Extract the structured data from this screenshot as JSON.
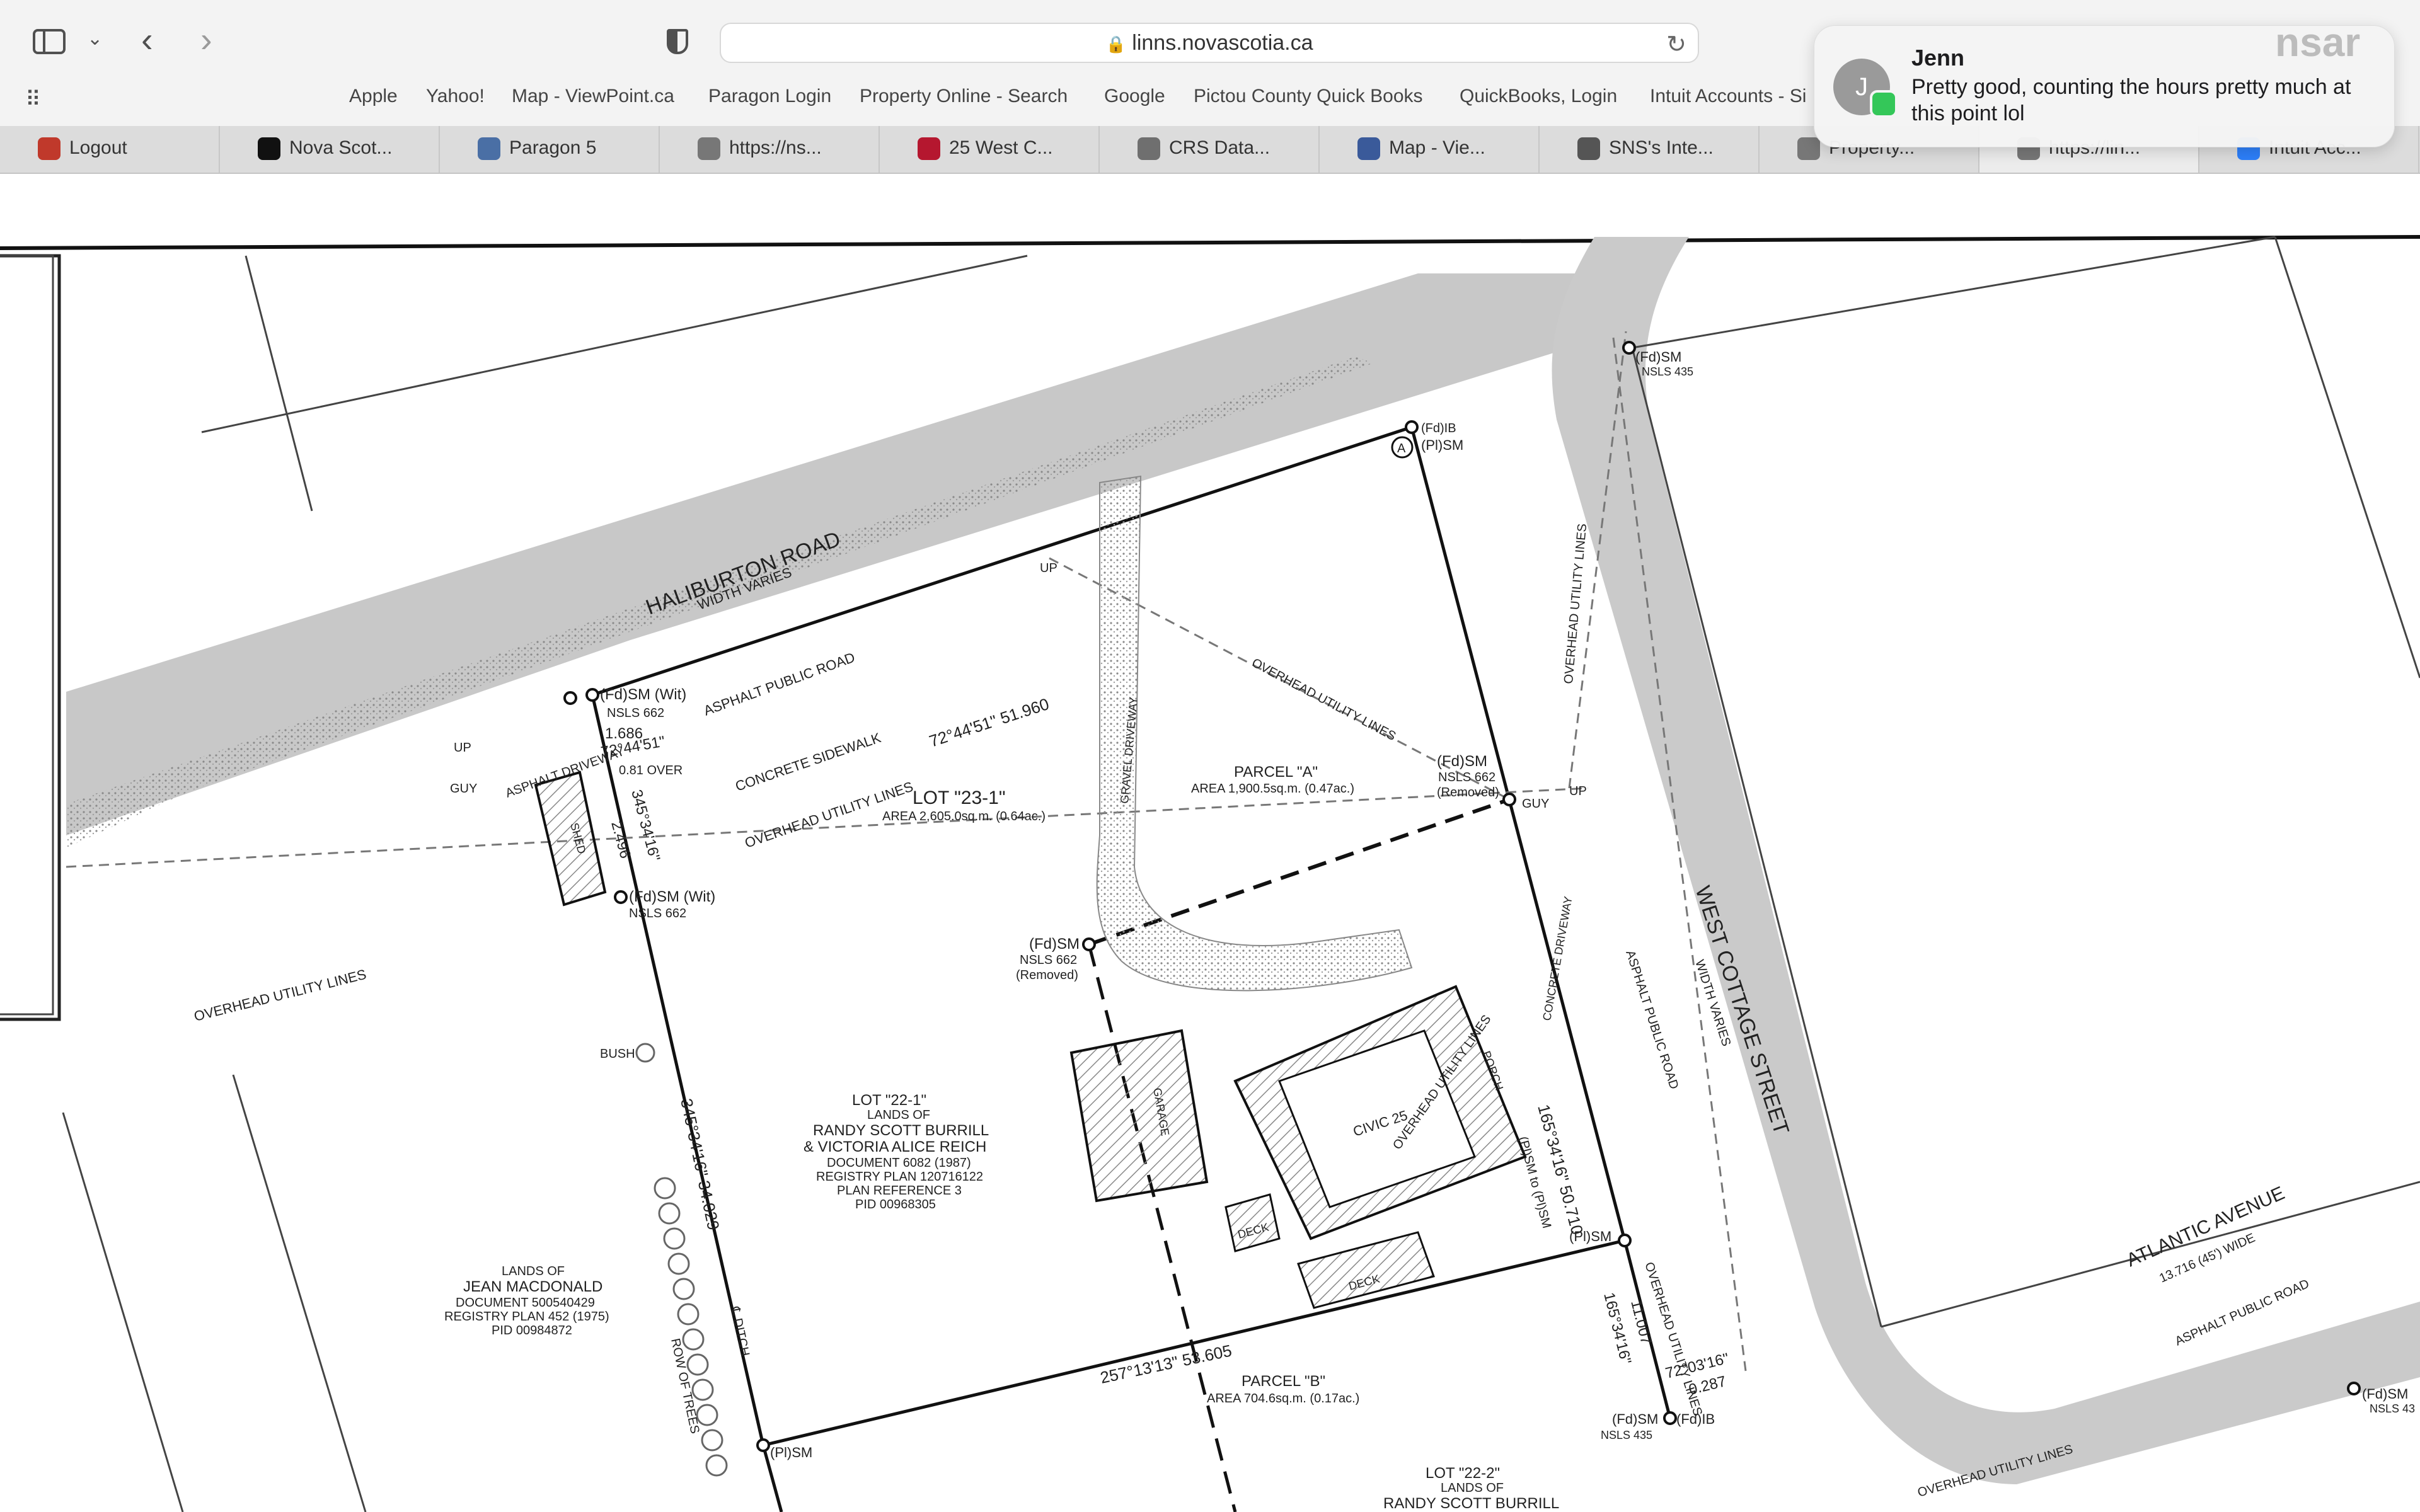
{
  "browser": {
    "url": "linns.novascotia.ca",
    "sidebar_icon": "sidebar-icon",
    "back_icon": "chevron-left-icon",
    "forward_icon": "chevron-right-icon",
    "privacy_icon": "shield-icon",
    "reload_icon": "reload-icon",
    "grid_icon": "grid-icon"
  },
  "bookmarks": [
    "Apple",
    "Yahoo!",
    "Map - ViewPoint.ca",
    "Paragon Login",
    "Property Online - Search",
    "Google",
    "Pictou County Quick Books",
    "QuickBooks, Login",
    "Intuit Accounts - Si"
  ],
  "tabs": [
    {
      "title": "Logout",
      "color": "#c0392b"
    },
    {
      "title": "Nova Scot...",
      "color": "#111111"
    },
    {
      "title": "Paragon 5",
      "color": "#4a6fa5"
    },
    {
      "title": "https://ns...",
      "color": "#777777"
    },
    {
      "title": "25 West C...",
      "color": "#b5172f"
    },
    {
      "title": "CRS Data...",
      "color": "#6f6f6f"
    },
    {
      "title": "Map - Vie...",
      "color": "#3a5a9a"
    },
    {
      "title": "SNS's Inte...",
      "color": "#555555"
    },
    {
      "title": "Property...",
      "color": "#777777"
    },
    {
      "title": "https://lin...",
      "color": "#777777"
    },
    {
      "title": "Intuit Acc...",
      "color": "#2d7ff9"
    }
  ],
  "notification": {
    "avatar_letter": "J",
    "sender": "Jenn",
    "message": "Pretty good, counting the hours pretty much at this point lol",
    "app_icon": "messages-icon"
  },
  "watermark": "nsar",
  "survey": {
    "haliburton_road": "HALIBURTON ROAD",
    "width_varies": "WIDTH VARIES",
    "asphalt_public_road": "ASPHALT PUBLIC ROAD",
    "concrete_sidewalk": "CONCRETE SIDEWALK",
    "overhead_utility_lines": "OVERHEAD UTILITY LINES",
    "bearing_north": "72°44'51\"  51.960",
    "up": "UP",
    "guy": "GUY",
    "fdsm_wit": "(Fd)SM (Wit)",
    "nsls_662": "NSLS 662",
    "nsls_435": "NSLS 435",
    "dist_1686": "1.686",
    "bearing_72": "72°44'51\"",
    "over": "0.81 OVER",
    "asphalt_driveway": "ASPHALT DRIVEWAY",
    "shed": "SHED",
    "bearing_345_short": "345°34'16\"",
    "dist_2496": "2.496",
    "lot_23_1": "LOT \"23-1\"",
    "lot_23_1_area": "AREA 2,605.0sq.m. (0.64ac.)",
    "gravel_driveway": "GRAVEL DRIVEWAY",
    "parcel_a": "PARCEL \"A\"",
    "parcel_a_area": "AREA 1,900.5sq.m. (0.47ac.)",
    "fdib": "(Fd)IB",
    "plsm": "(Pl)SM",
    "fdsm": "(Fd)SM",
    "removed": "(Removed)",
    "fdsm_top": "(Fd)SM",
    "west_cottage_street": "WEST COTTAGE STREET",
    "concrete_driveway": "CONCRETE DRIVEWAY",
    "bearing_east": "165°34'16\"  50.710",
    "plsm_to_plsm": "(Pl)SM to (Pl)SM",
    "bush": "BUSH",
    "lot_22_1": "LOT \"22-1\"",
    "lands_of": "LANDS OF",
    "owner_1": "RANDY SCOTT BURRILL",
    "owner_2": "& VICTORIA ALICE REICH",
    "doc_6082": "DOCUMENT 6082 (1987)",
    "registry_plan": "REGISTRY PLAN 120716122",
    "plan_reference": "PLAN REFERENCE 3",
    "pid_968305": "PID 00968305",
    "garage": "GARAGE",
    "deck": "DECK",
    "civic_25": "CIVIC 25",
    "porch": "PORCH",
    "parcel_b": "PARCEL \"B\"",
    "parcel_b_area": "AREA 704.6sq.m. (0.17ac.)",
    "bearing_west": "345°34'16\"  34.029",
    "ditch": "℄ DITCH",
    "row_of_trees": "ROW OF TREES",
    "jean_lands_of": "LANDS OF",
    "jean_name": "JEAN MACDONALD",
    "jean_doc": "DOCUMENT 500540429",
    "jean_plan": "REGISTRY PLAN 452 (1975)",
    "jean_pid": "PID 00984872",
    "bearing_south": "257°13'13\"  53.605",
    "bearing_165_short": "165°34'16\"",
    "dist_11007": "11.007",
    "bearing_72_03": "72°03'16\"",
    "dist_0287": "0.287",
    "atlantic_avenue": "ATLANTIC AVENUE",
    "atlantic_width": "13.716 (45') WIDE",
    "lot_22_2": "LOT \"22-2\"",
    "nsls_43": "NSLS 43",
    "a_marker": "A"
  }
}
